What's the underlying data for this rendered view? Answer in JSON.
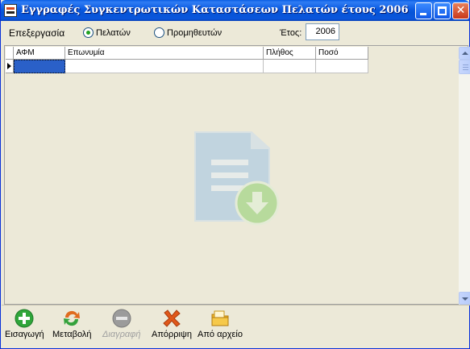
{
  "window": {
    "title": "Εγγραφές Συγκεντρωτικών Καταστάσεων Πελατών έτους 2006",
    "close_glyph": "✕"
  },
  "options": {
    "label": "Επεξεργασία",
    "radio_customers": "Πελατών",
    "radio_suppliers": "Προμηθευτών",
    "selected": "customers",
    "year_label": "Έτος:",
    "year_value": "2006"
  },
  "grid": {
    "columns": [
      "ΑΦΜ",
      "Επωνυμία",
      "Πλήθος",
      "Ποσό"
    ],
    "rows": [
      [
        "",
        "",
        "",
        ""
      ]
    ]
  },
  "toolbar": {
    "items": [
      {
        "label": "Εισαγωγή",
        "icon": "add-icon",
        "enabled": true
      },
      {
        "label": "Μεταβολή",
        "icon": "refresh-icon",
        "enabled": true
      },
      {
        "label": "Διαγραφή",
        "icon": "remove-icon",
        "enabled": false
      },
      {
        "label": "Απόρριψη",
        "icon": "reject-icon",
        "enabled": true
      },
      {
        "label": "Από αρχείο",
        "icon": "import-file-icon",
        "enabled": true
      }
    ]
  },
  "colors": {
    "titlebar": "#0a5ae0",
    "selection": "#2a60c8",
    "background": "#ece9d8"
  }
}
